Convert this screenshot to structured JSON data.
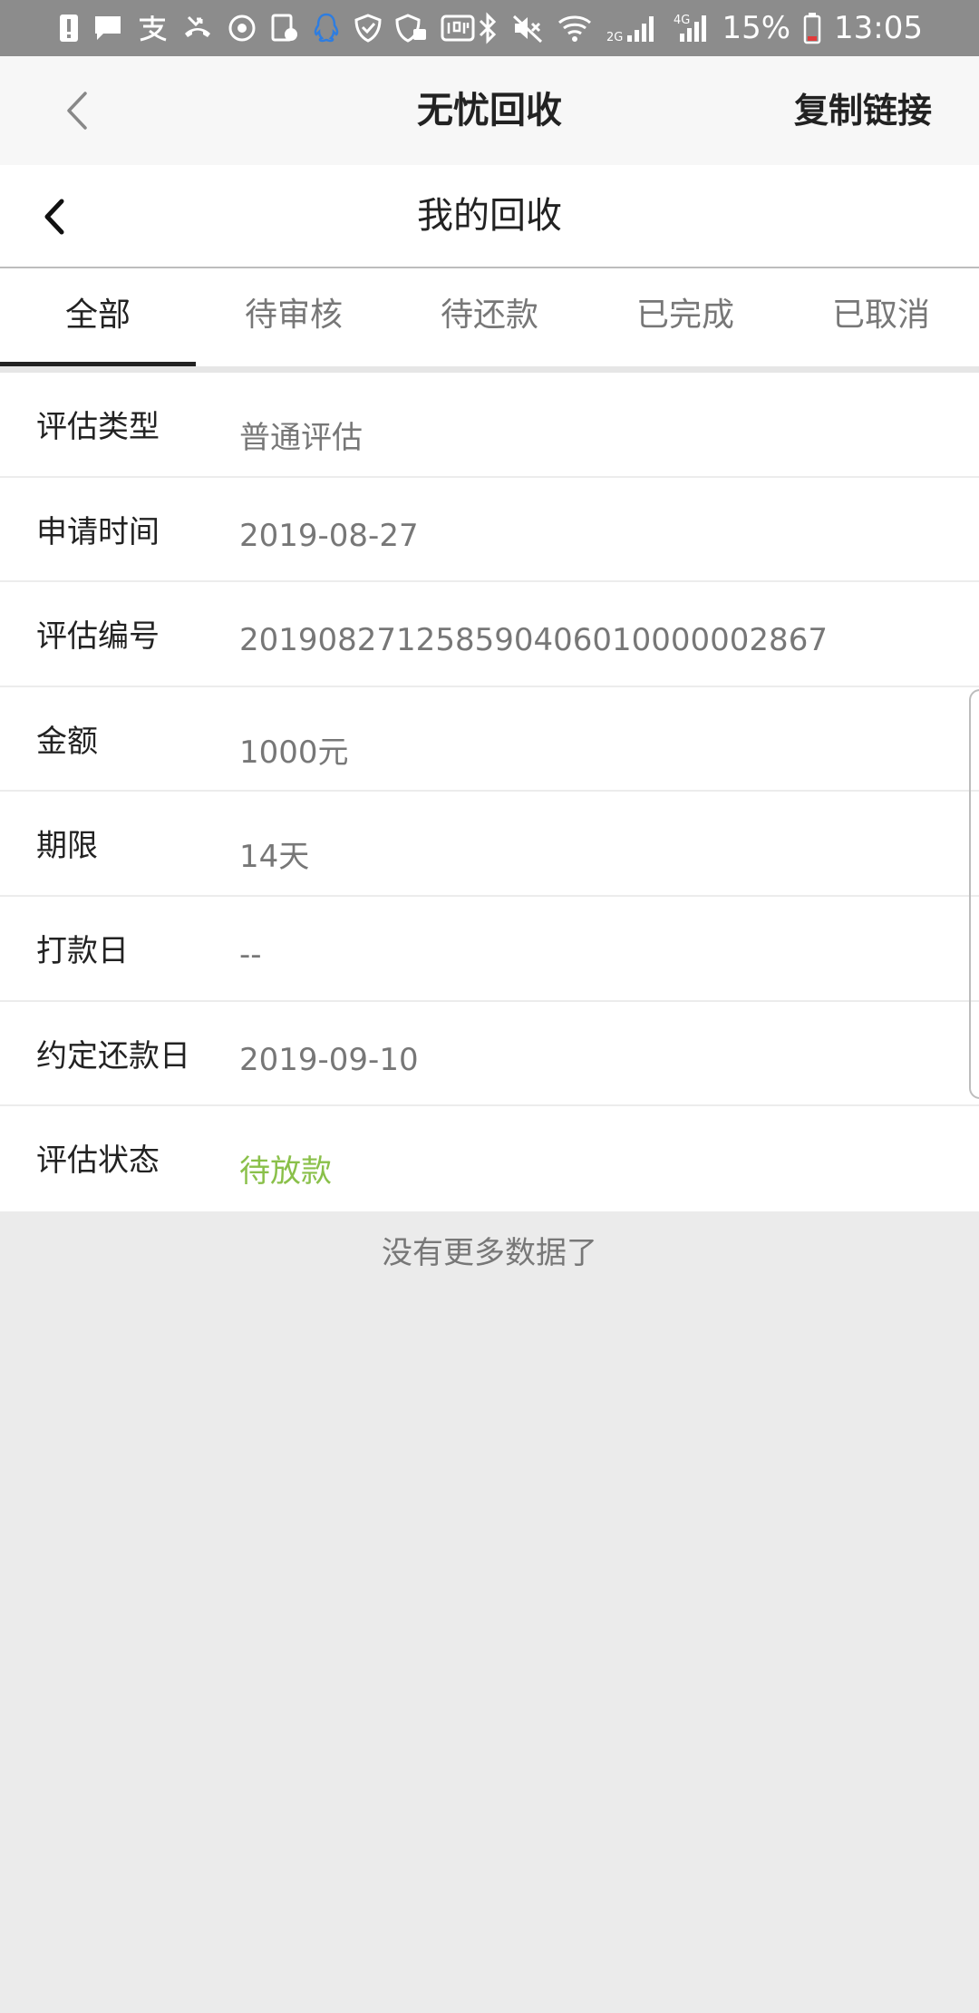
{
  "status_bar": {
    "battery": "15%",
    "time": "13:05",
    "network_2g": "2G",
    "network_4g": "4G"
  },
  "app_header": {
    "title": "无忧回收",
    "copy_link_label": "复制链接"
  },
  "page_header": {
    "title": "我的回收"
  },
  "tabs": [
    {
      "label": "全部",
      "active": true
    },
    {
      "label": "待审核",
      "active": false
    },
    {
      "label": "待还款",
      "active": false
    },
    {
      "label": "已完成",
      "active": false
    },
    {
      "label": "已取消",
      "active": false
    }
  ],
  "details": [
    {
      "label": "评估类型",
      "value": "普通评估"
    },
    {
      "label": "申请时间",
      "value": "2019-08-27"
    },
    {
      "label": "评估编号",
      "value": "2019082712585904060100000028 67"
    },
    {
      "label": "金额",
      "value": "1000元"
    },
    {
      "label": "期限",
      "value": "14天"
    },
    {
      "label": "打款日",
      "value": "--"
    },
    {
      "label": "约定还款日",
      "value": "2019-09-10"
    },
    {
      "label": "评估状态",
      "value": "待放款"
    }
  ],
  "footer": {
    "no_more_text": "没有更多数据了"
  },
  "colors": {
    "status_bar_bg": "#8c8c8c",
    "status_green": "#8ac04a",
    "page_bg": "#ebebeb",
    "qq_icon_blue": "#2e7de0"
  }
}
